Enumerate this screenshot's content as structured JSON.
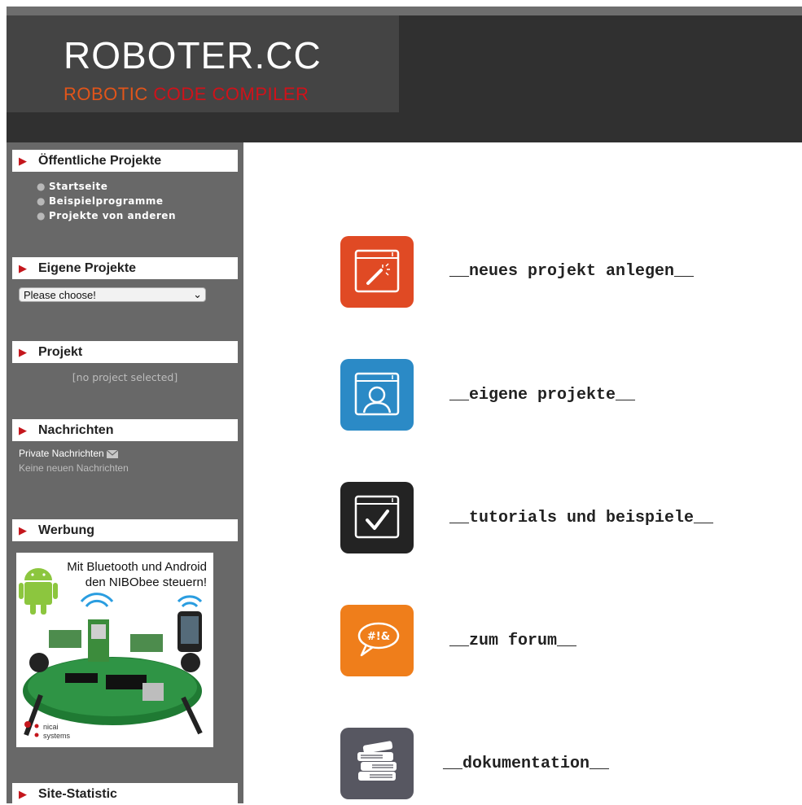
{
  "header": {
    "title": "ROBOTER.CC",
    "subtitle_part1": "ROBOTIC",
    "subtitle_part2": "CODE COMPILER"
  },
  "sidebar": {
    "public_projects": {
      "heading": "Öffentliche Projekte",
      "links": [
        "Startseite",
        "Beispielprogramme",
        "Projekte von anderen"
      ]
    },
    "own_projects": {
      "heading": "Eigene Projekte",
      "select_value": "Please choose!"
    },
    "project": {
      "heading": "Projekt",
      "status": "[no project selected]"
    },
    "messages": {
      "heading": "Nachrichten",
      "private_label": "Private Nachrichten",
      "status": "Keine neuen Nachrichten"
    },
    "ads": {
      "heading": "Werbung",
      "banner_line1": "Mit Bluetooth und Android",
      "banner_line2": "den NIBObee steuern!",
      "brand_line1": "nicai",
      "brand_line2": "systems"
    },
    "stats": {
      "heading": "Site-Statistic"
    }
  },
  "main": {
    "actions": [
      {
        "label": "__neues projekt anlegen__",
        "icon": "magic-wand-window-icon",
        "color": "#e04a24"
      },
      {
        "label": "__eigene projekte__",
        "icon": "user-window-icon",
        "color": "#2b8ac6"
      },
      {
        "label": "__tutorials und beispiele__",
        "icon": "checkmark-window-icon",
        "color": "#232323"
      },
      {
        "label": "__zum forum__",
        "icon": "speech-bubble-icon",
        "color": "#ef7e1b"
      },
      {
        "label": "__dokumentation__",
        "icon": "books-icon",
        "color": "#575761"
      }
    ]
  },
  "colors": {
    "header_bg": "#303030",
    "logo_bg": "#444444",
    "sidebar_bg": "#686868",
    "accent_red": "#c4161c",
    "accent_orange": "#e2551a"
  }
}
